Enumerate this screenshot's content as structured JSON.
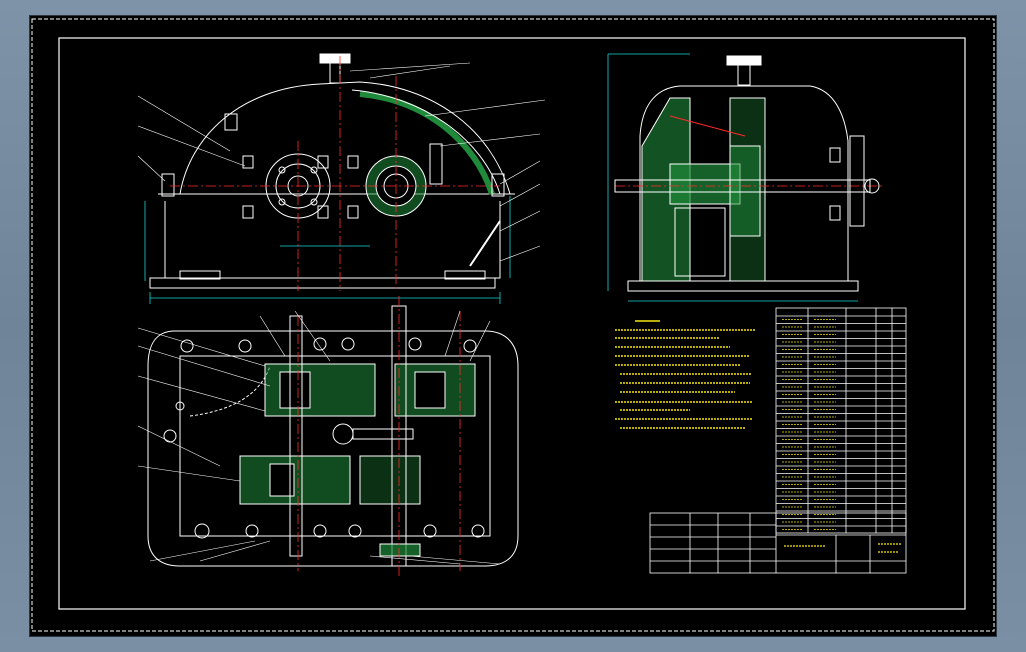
{
  "colors": {
    "background": "#000000",
    "frame": "#ffffff",
    "outline": "#ffffff",
    "centerline": "#ff2a2a",
    "section_fill": "#1f8a3a",
    "section_dark": "#0d5a24",
    "dimension": "#19d6d6",
    "note_text": "#f5e614",
    "leader": "#ffffff",
    "viewport_border": "#2b3642"
  },
  "views": {
    "front": "front-elevation-view",
    "side": "side-section-view",
    "plan": "plan-section-view"
  },
  "icons": {
    "oil_cap": "breather-cap-icon",
    "bolt": "bolt-circle-icon",
    "bearing": "bearing-cover-icon"
  }
}
